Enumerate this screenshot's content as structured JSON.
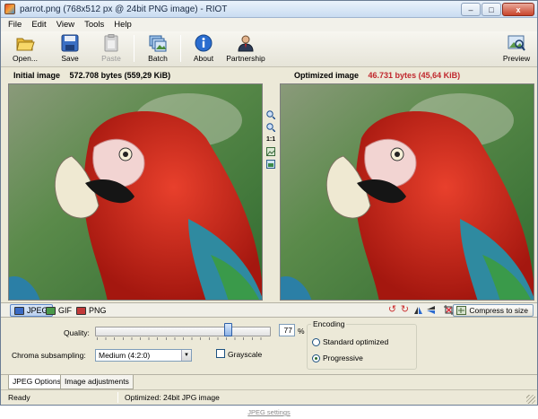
{
  "window": {
    "title": "parrot.png (768x512 px @ 24bit PNG image) - RIOT",
    "minimize": "–",
    "maximize": "□",
    "close": "x"
  },
  "menu": {
    "items": [
      "File",
      "Edit",
      "View",
      "Tools",
      "Help"
    ]
  },
  "toolbar": {
    "open_label": "Open...",
    "save_label": "Save",
    "paste_label": "Paste",
    "batch_label": "Batch",
    "about_label": "About",
    "partnership_label": "Partnership",
    "preview_label": "Preview"
  },
  "initial": {
    "label": "Initial image",
    "size": "572.708 bytes (559,29 KiB)"
  },
  "optimized": {
    "label": "Optimized image",
    "size": "46.731 bytes (45,64 KiB)"
  },
  "zoom": {
    "one_to_one": "1:1"
  },
  "formats": {
    "jpeg": "JPEG",
    "gif": "GIF",
    "png": "PNG",
    "compress_label": "Compress to size"
  },
  "options": {
    "quality_label": "Quality:",
    "quality_value": "77",
    "quality_unit": "%",
    "quality_fraction": 0.77,
    "chroma_label": "Chroma subsampling:",
    "chroma_value": "Medium (4:2:0)",
    "grayscale_label": "Grayscale",
    "encoding_title": "Encoding",
    "encoding_standard": "Standard optimized",
    "encoding_progressive": "Progressive"
  },
  "bottom_tabs": [
    "JPEG Options",
    "Image adjustments"
  ],
  "status": {
    "left": "Ready",
    "right": "Optimized: 24bit JPG image"
  },
  "caption": "JPEG settings",
  "colors": {
    "optimized_size": "#c0272d",
    "parrot_red": "#c8221c",
    "background_green": "#3f8a3a"
  }
}
